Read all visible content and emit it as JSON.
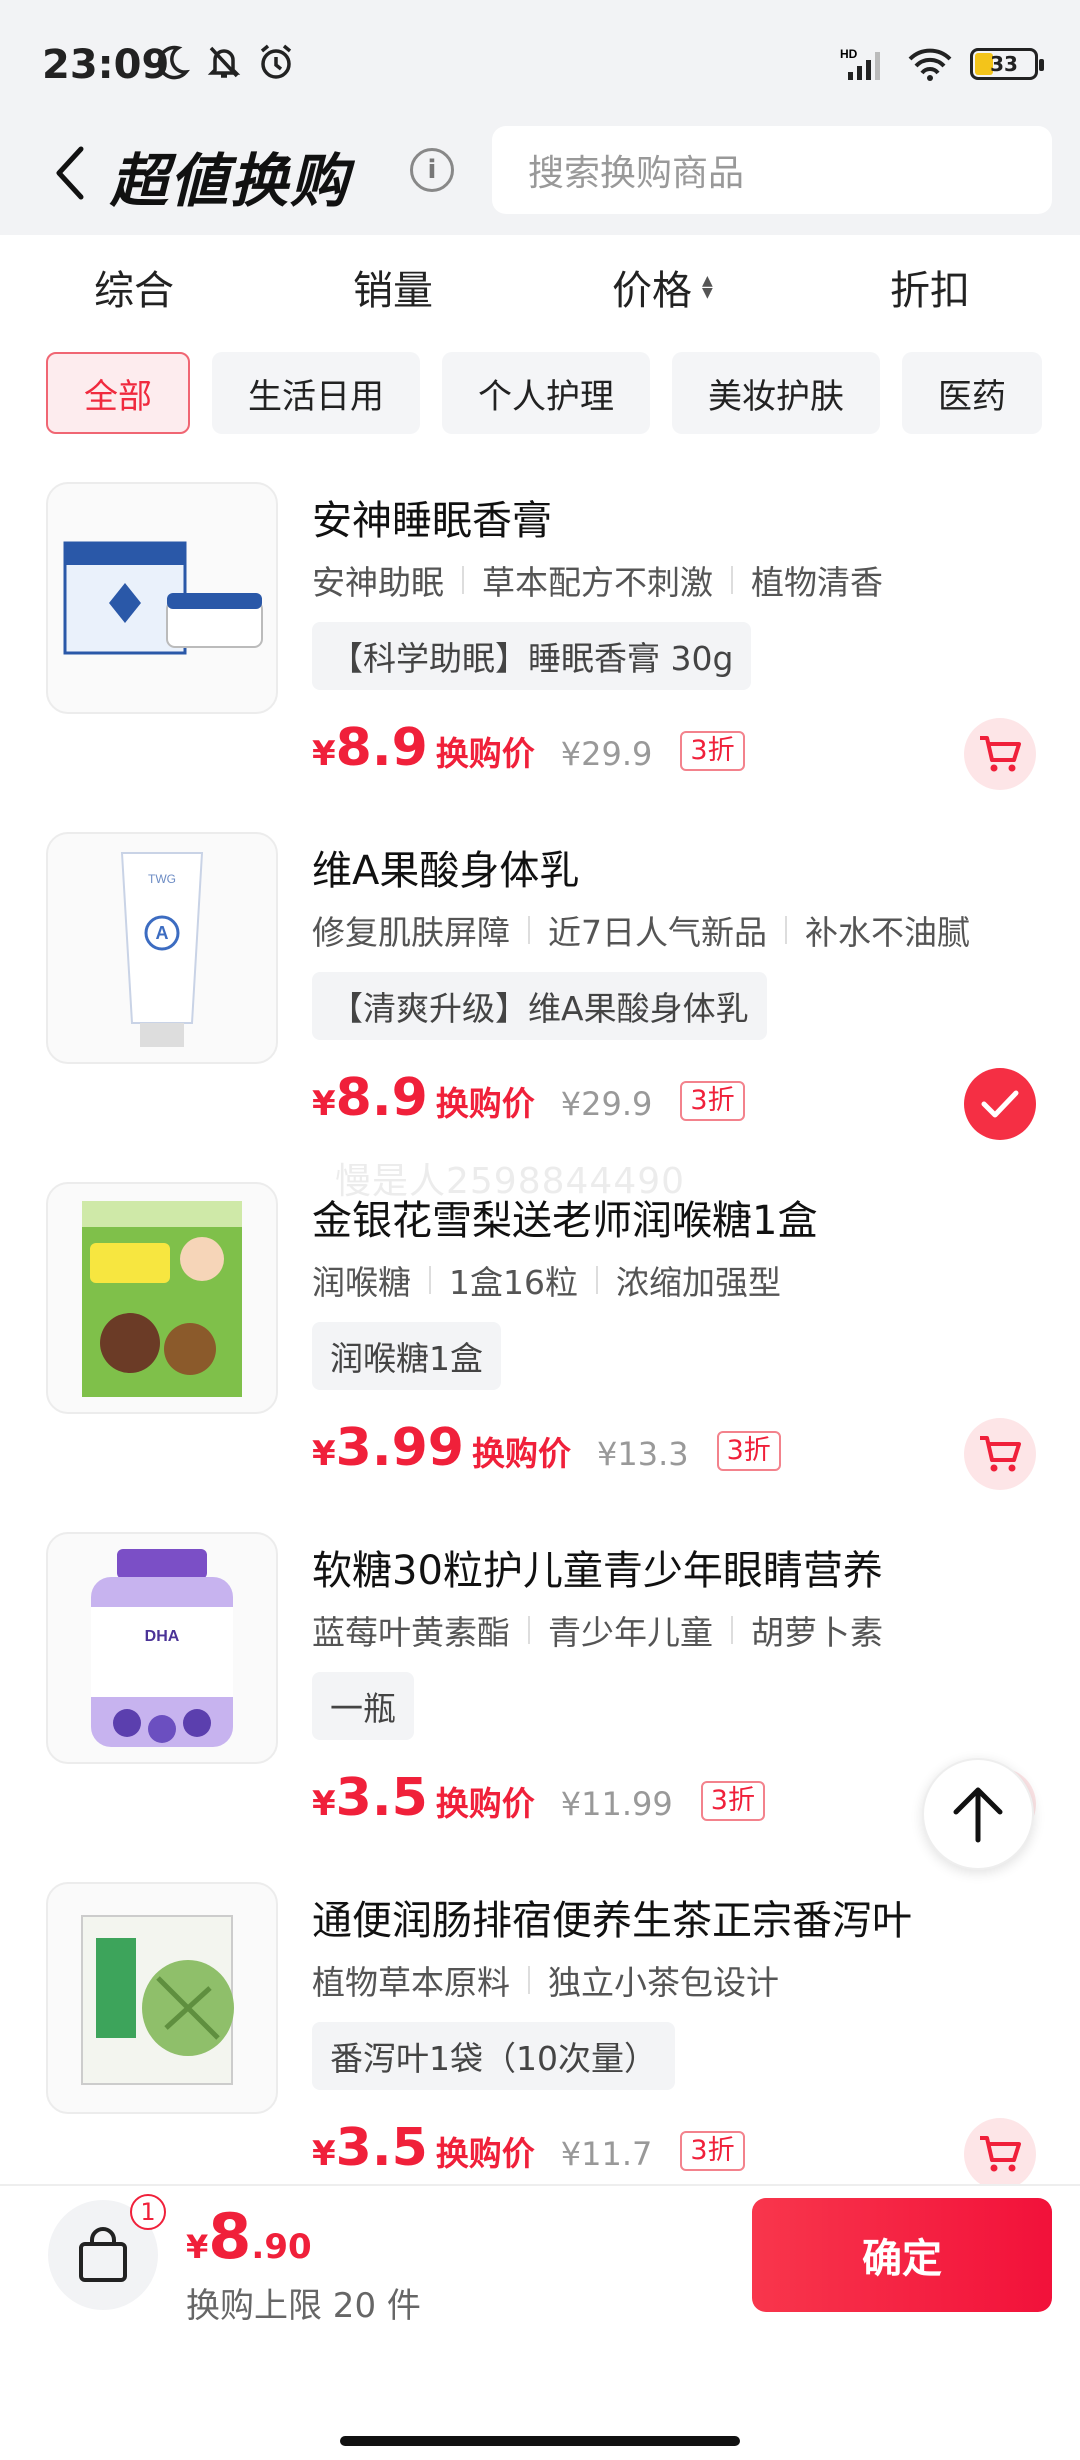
{
  "status_bar": {
    "time": "23:09",
    "battery": "33",
    "network": "HD"
  },
  "header": {
    "title": "超値换购",
    "search_placeholder": "搜索换购商品"
  },
  "sort_tabs": [
    {
      "label": "综合"
    },
    {
      "label": "销量"
    },
    {
      "label": "价格"
    },
    {
      "label": "折扣"
    }
  ],
  "categories": [
    {
      "label": "全部",
      "active": true
    },
    {
      "label": "生活日用"
    },
    {
      "label": "个人护理"
    },
    {
      "label": "美妆护肤"
    },
    {
      "label": "医药"
    }
  ],
  "products": [
    {
      "title": "安神睡眠香膏",
      "tags": [
        "安神助眠",
        "草本配方不刺激",
        "植物清香"
      ],
      "spec": "【科学助眠】睡眠香膏 30g",
      "price": "8.9",
      "price_label": "换购价",
      "original_price": "¥29.9",
      "discount": "3折",
      "selected": false
    },
    {
      "title": "维A果酸身体乳",
      "tags": [
        "修复肌肤屏障",
        "近7日人气新品",
        "补水不油腻"
      ],
      "spec": "【清爽升级】维A果酸身体乳",
      "price": "8.9",
      "price_label": "换购价",
      "original_price": "¥29.9",
      "discount": "3折",
      "selected": true
    },
    {
      "title": "金银花雪梨送老师润喉糖1盒",
      "tags": [
        "润喉糖",
        "1盒16粒",
        "浓缩加强型"
      ],
      "spec": "润喉糖1盒",
      "price": "3.99",
      "price_label": "换购价",
      "original_price": "¥13.3",
      "discount": "3折",
      "selected": false
    },
    {
      "title": "软糖30粒护儿童青少年眼睛营养",
      "tags": [
        "蓝莓叶黄素酯",
        "青少年儿童",
        "胡萝卜素"
      ],
      "spec": "一瓶",
      "price": "3.5",
      "price_label": "换购价",
      "original_price": "¥11.99",
      "discount": "3折",
      "selected": false
    },
    {
      "title": "通便润肠排宿便养生茶正宗番泻叶",
      "tags": [
        "植物草本原料",
        "独立小茶包设计"
      ],
      "spec": "番泻叶1袋（10次量）",
      "price": "3.5",
      "price_label": "换购价",
      "original_price": "¥11.7",
      "discount": "3折",
      "selected": false
    }
  ],
  "watermark": "慢是人2598844490",
  "bottom_bar": {
    "cart_count": "1",
    "currency": "¥",
    "total_int": "8",
    "total_dec": ".90",
    "limit_text": "换购上限 20 件",
    "confirm_label": "确定"
  },
  "colors": {
    "accent": "#f0203a",
    "chip_active_bg": "#fdecee",
    "header_bg": "#f2f3f5"
  }
}
